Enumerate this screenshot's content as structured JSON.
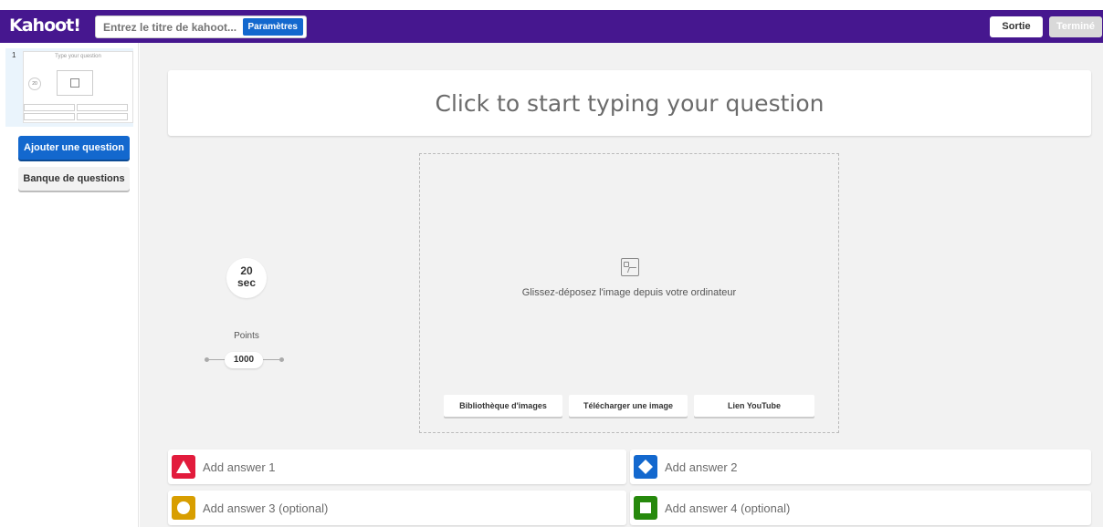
{
  "header": {
    "logo": "Kahoot!",
    "title_placeholder": "Entrez le titre de kahoot...",
    "settings_label": "Paramètres",
    "exit_label": "Sortie",
    "done_label": "Terminé"
  },
  "sidebar": {
    "slide_number": "1",
    "thumb_question": "Type your question",
    "thumb_timer": "20",
    "add_question_label": "Ajouter une question",
    "question_bank_label": "Banque de questions"
  },
  "question": {
    "placeholder": "Click to start typing your question"
  },
  "timer": {
    "value": "20",
    "unit": "sec"
  },
  "points": {
    "label": "Points",
    "value": "1000"
  },
  "media": {
    "drop_text": "Glissez-déposez l'image depuis votre ordinateur",
    "buttons": [
      "Bibliothèque d'images",
      "Télécharger une image",
      "Lien YouTube"
    ]
  },
  "answers": [
    {
      "label": "Add answer 1",
      "shape": "triangle",
      "color": "#e21b3c"
    },
    {
      "label": "Add answer 2",
      "shape": "diamond",
      "color": "#1368ce"
    },
    {
      "label": "Add answer 3 (optional)",
      "shape": "circle",
      "color": "#d89e00"
    },
    {
      "label": "Add answer 4 (optional)",
      "shape": "square",
      "color": "#26890c"
    }
  ],
  "colors": {
    "brand_purple": "#46178f",
    "primary_blue": "#1368ce"
  }
}
